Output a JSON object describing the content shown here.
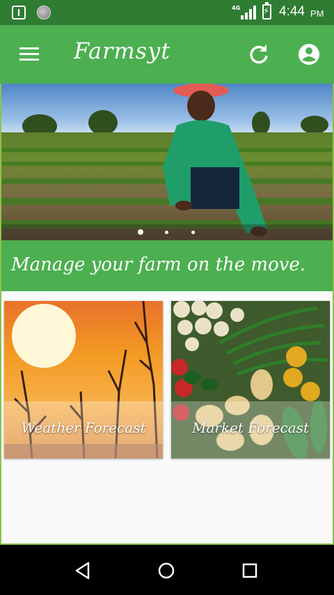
{
  "status_bar": {
    "network_label": "4G",
    "time": "4:44",
    "ampm": "PM",
    "icons": [
      "usb-icon",
      "notification-icon",
      "signal-icon",
      "battery-charging-icon"
    ]
  },
  "app_bar": {
    "title": "Farmsyt",
    "icons": {
      "menu": "menu-icon",
      "refresh": "refresh-icon",
      "account": "account-circle-icon"
    }
  },
  "carousel": {
    "slide_count": 3,
    "active_slide": 1
  },
  "tagline": "Manage your farm on the move.",
  "cards": [
    {
      "label": "Weather Forecast"
    },
    {
      "label": "Market Forecast"
    }
  ],
  "nav_bar": {
    "icons": [
      "back-icon",
      "home-icon",
      "recents-icon"
    ]
  },
  "colors": {
    "status_bar": "#2e7d32",
    "primary": "#4caf50",
    "frame_border": "#8bc34a",
    "nav_bar": "#000000"
  }
}
